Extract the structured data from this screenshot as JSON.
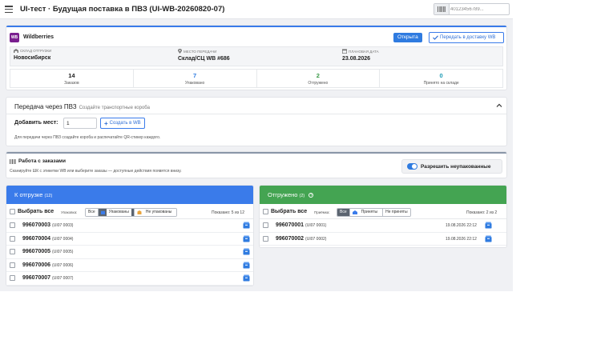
{
  "header": {
    "title": "UI-тест · Будущая поставка в ПВЗ (UI-WB-20260820-07)",
    "scan_placeholder": "40123456789..."
  },
  "shipment": {
    "logo_text": "WB",
    "marketplace": "Wildberries",
    "status": "Открыта",
    "transfer_button": "Передать в доставку WB",
    "info": [
      {
        "label": "СКЛАД ОТГРУЗКИ",
        "value": "Новосибирск",
        "icon": "warehouse-icon"
      },
      {
        "label": "МЕСТО ПЕРЕДАЧИ",
        "value": "Склад/СЦ WB #686",
        "icon": "location-pin-icon"
      },
      {
        "label": "ПЛАНОВАЯ ДАТА",
        "value": "23.08.2026",
        "icon": "calendar-icon"
      }
    ],
    "stats": [
      {
        "value": "14",
        "caption": "Заказов",
        "color": "#222222"
      },
      {
        "value": "7",
        "caption": "Упаковано",
        "color": "#2f7be0"
      },
      {
        "value": "2",
        "caption": "Отгружено",
        "color": "#3a9a48"
      },
      {
        "value": "0",
        "caption": "Принято на складе",
        "color": "#1e9bb5"
      }
    ]
  },
  "pvz": {
    "title": "Передача через ПВЗ",
    "subtitle": "Создайте транспортные короба",
    "places_label": "Добавить мест:",
    "places_value": "1",
    "create_button": "Создать в WB",
    "hint": "Для передачи через ПВЗ создайте короба и распечатайте QR-стикер каждого."
  },
  "orders_work": {
    "title": "Работа с заказами",
    "hint": "Сканируйте ШК с этикетки WB или выберите заказы — доступные действия появятся внизу.",
    "toggle_label": "Разрешить неупакованные",
    "toggle_on": true
  },
  "to_ship": {
    "title": "К отгрузке",
    "count": "(12)",
    "select_all": "Выбрать все",
    "filter_label": "Упаковка:",
    "filters": [
      {
        "label": "Все",
        "active": false
      },
      {
        "label": "Упакованы",
        "active": true,
        "icon": "box-icon"
      },
      {
        "label": "Не упакованы",
        "active": false,
        "icon": "open-box-icon"
      }
    ],
    "shown": "Показано: 5 из 12",
    "rows": [
      {
        "number": "996070003",
        "code": "(UI07 0003)"
      },
      {
        "number": "996070004",
        "code": "(UI07 0004)"
      },
      {
        "number": "996070005",
        "code": "(UI07 0005)"
      },
      {
        "number": "996070006",
        "code": "(UI07 0006)"
      },
      {
        "number": "996070007",
        "code": "(UI07 0007)"
      }
    ]
  },
  "shipped": {
    "title": "Отгружено",
    "count": "(2)",
    "select_all": "Выбрать все",
    "filter_label": "Приёмка:",
    "filters": [
      {
        "label": "Все",
        "active": true
      },
      {
        "label": "Приняты",
        "active": false,
        "icon": "warehouse-icon"
      },
      {
        "label": "Не приняты",
        "active": false
      }
    ],
    "shown": "Показано: 2 из 2",
    "rows": [
      {
        "number": "996070001",
        "code": "(UI07 0001)",
        "date": "19.08.2026 22:12"
      },
      {
        "number": "996070002",
        "code": "(UI07 0002)",
        "date": "19.08.2026 22:12"
      }
    ]
  }
}
